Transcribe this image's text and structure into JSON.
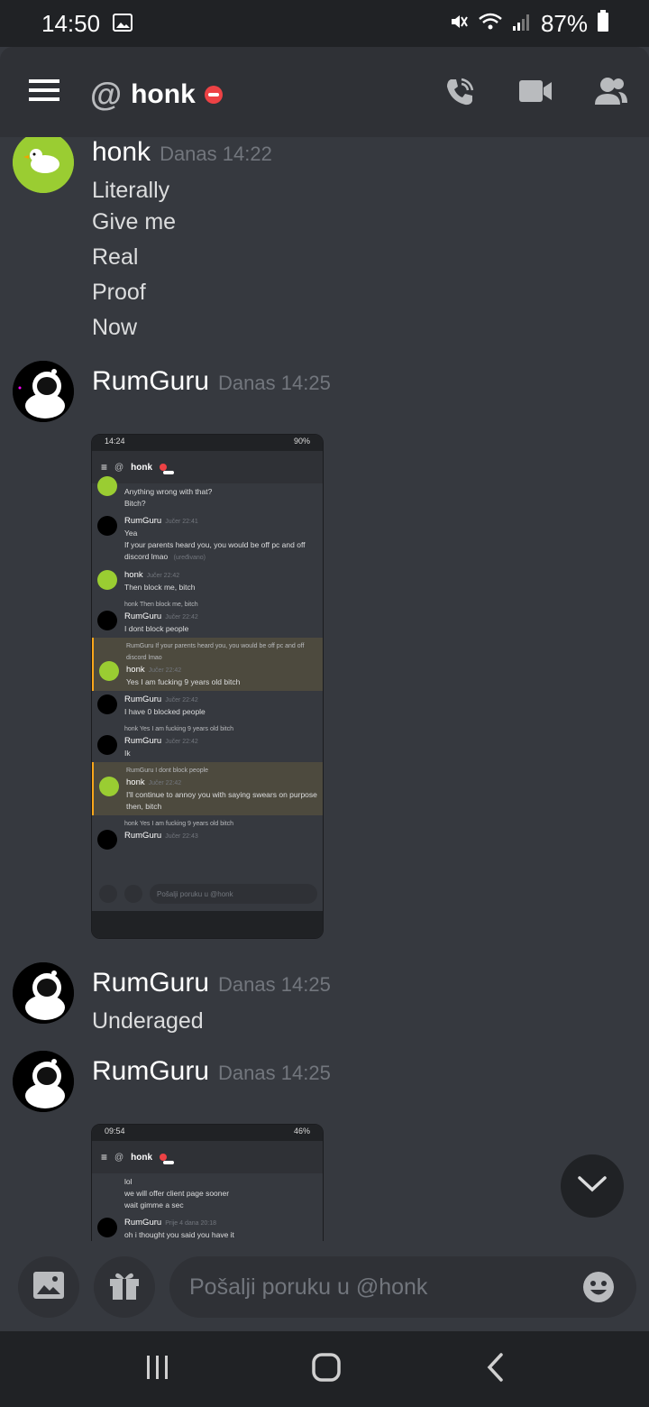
{
  "status_bar": {
    "time": "14:50",
    "battery": "87%"
  },
  "header": {
    "at": "@",
    "title": "honk"
  },
  "messages": [
    {
      "user": "honk",
      "time": "Danas 14:22",
      "lines": [
        "Literally",
        "Give me",
        "Real",
        "Proof",
        "Now"
      ]
    },
    {
      "user": "RumGuru",
      "time": "Danas 14:25"
    },
    {
      "user": "RumGuru",
      "time": "Danas 14:25",
      "lines": [
        "Underaged"
      ]
    },
    {
      "user": "RumGuru",
      "time": "Danas 14:25"
    }
  ],
  "screenshot1": {
    "status_time": "14:24",
    "status_battery": "90%",
    "title": "honk",
    "items": [
      {
        "user": "",
        "time": "",
        "lines": [
          "Anything wrong with that?",
          "Bitch?"
        ]
      },
      {
        "user": "RumGuru",
        "time": "Jučer 22:41",
        "lines": [
          "Yea",
          "If your parents heard you, you would be off pc and off discord lmao"
        ],
        "edited": "(uređivano)"
      },
      {
        "user": "honk",
        "time": "Jučer 22:42",
        "lines": [
          "Then block me, bitch"
        ]
      },
      {
        "reply": "honk Then block me, bitch",
        "user": "RumGuru",
        "time": "Jučer 22:42",
        "lines": [
          "I dont block people"
        ]
      },
      {
        "reply": "RumGuru If your parents heard you, you would be off pc and off discord lmao",
        "user": "honk",
        "time": "Jučer 22:42",
        "lines": [
          "Yes I am fucking 9 years old bitch"
        ],
        "hl": true
      },
      {
        "user": "RumGuru",
        "time": "Jučer 22:42",
        "lines": [
          "I have 0 blocked people"
        ]
      },
      {
        "reply": "honk Yes I am fucking 9 years old bitch",
        "user": "RumGuru",
        "time": "Jučer 22:42",
        "lines": [
          "Ik"
        ]
      },
      {
        "reply": "RumGuru I dont block people",
        "user": "honk",
        "time": "Jučer 22:42",
        "lines": [
          "I'll continue to annoy you with saying swears on purpose then, bitch"
        ],
        "hl": true
      },
      {
        "reply": "honk Yes I am fucking 9 years old bitch",
        "user": "RumGuru",
        "time": "Jučer 22:43",
        "lines": []
      }
    ],
    "composer_placeholder": "Pošalji poruku u @honk"
  },
  "screenshot2": {
    "status_time": "09:54",
    "status_battery": "46%",
    "title": "honk",
    "lines_top": [
      "lol",
      "we will offer client page sooner",
      "wait gimme a sec"
    ],
    "user": "RumGuru",
    "time": "Prije 4 dana 20:18",
    "line_bottom": "oh i thought you said you have it"
  },
  "composer": {
    "placeholder": "Pošalji poruku u @honk"
  },
  "colors": {
    "bg": "#36393f",
    "header": "#2f3136",
    "dark": "#202225",
    "dnd": "#ed4245",
    "accent_highlight": "#faa61a"
  }
}
